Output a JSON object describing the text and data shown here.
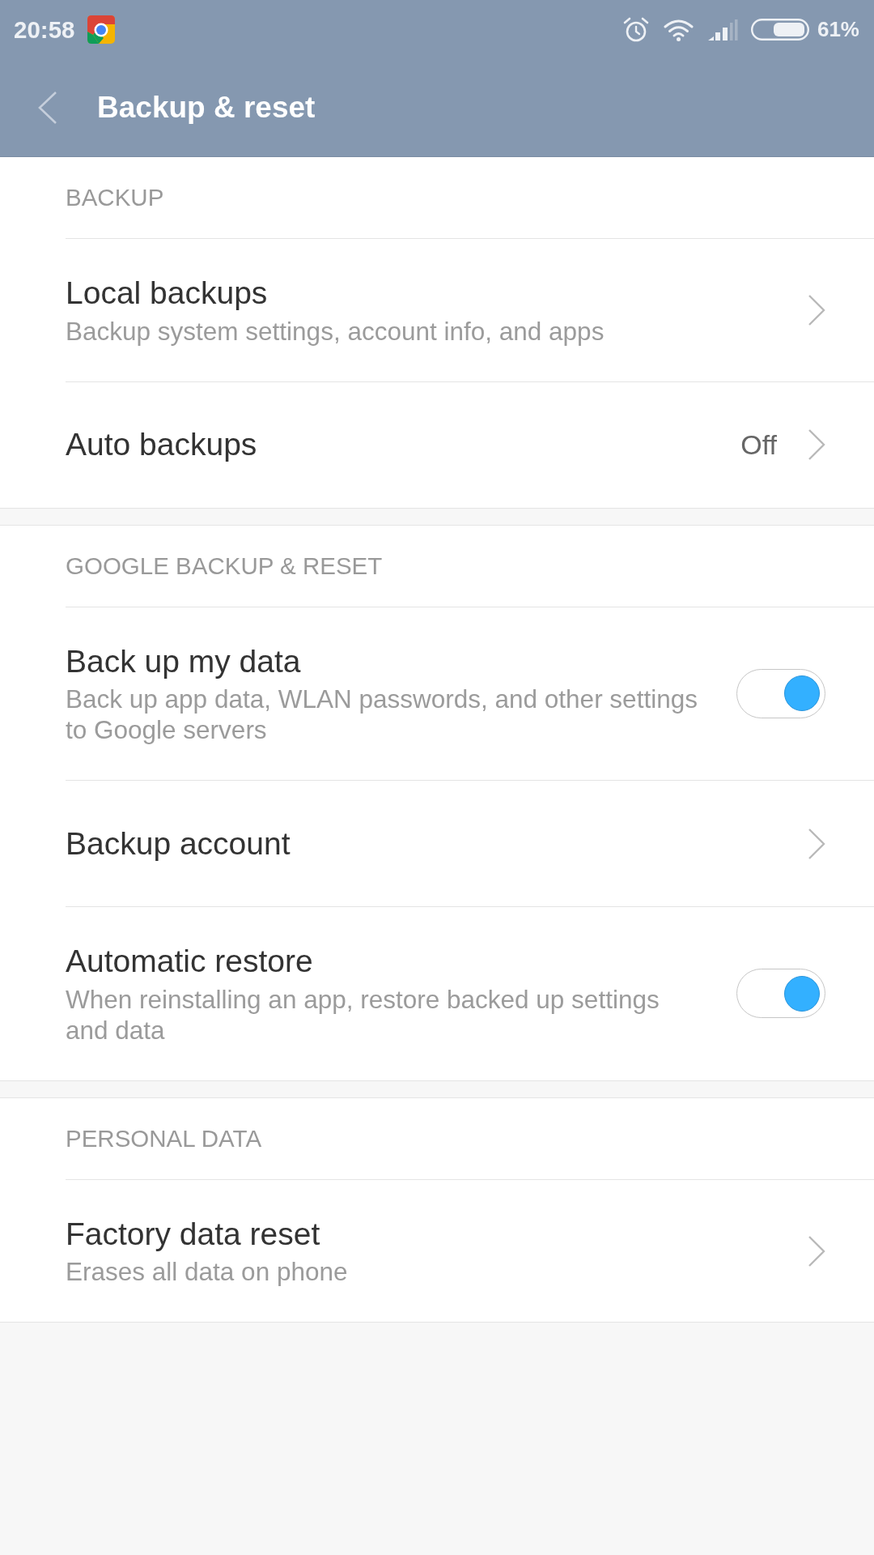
{
  "status_bar": {
    "time": "20:58",
    "battery_text": "61%"
  },
  "header": {
    "title": "Backup & reset"
  },
  "sections": [
    {
      "title": "BACKUP",
      "items": [
        {
          "kind": "link",
          "title": "Local backups",
          "subtitle": "Backup system settings, account info, and apps"
        },
        {
          "kind": "link",
          "title": "Auto backups",
          "value": "Off"
        }
      ]
    },
    {
      "title": "GOOGLE BACKUP & RESET",
      "items": [
        {
          "kind": "toggle",
          "title": "Back up my data",
          "subtitle": "Back up app data, WLAN passwords, and other settings to Google servers",
          "on": true
        },
        {
          "kind": "link",
          "title": "Backup account"
        },
        {
          "kind": "toggle",
          "title": "Automatic restore",
          "subtitle": "When reinstalling an app, restore backed up settings and data",
          "on": true
        }
      ]
    },
    {
      "title": "PERSONAL DATA",
      "items": [
        {
          "kind": "link",
          "title": "Factory data reset",
          "subtitle": "Erases all data on phone"
        }
      ]
    }
  ]
}
